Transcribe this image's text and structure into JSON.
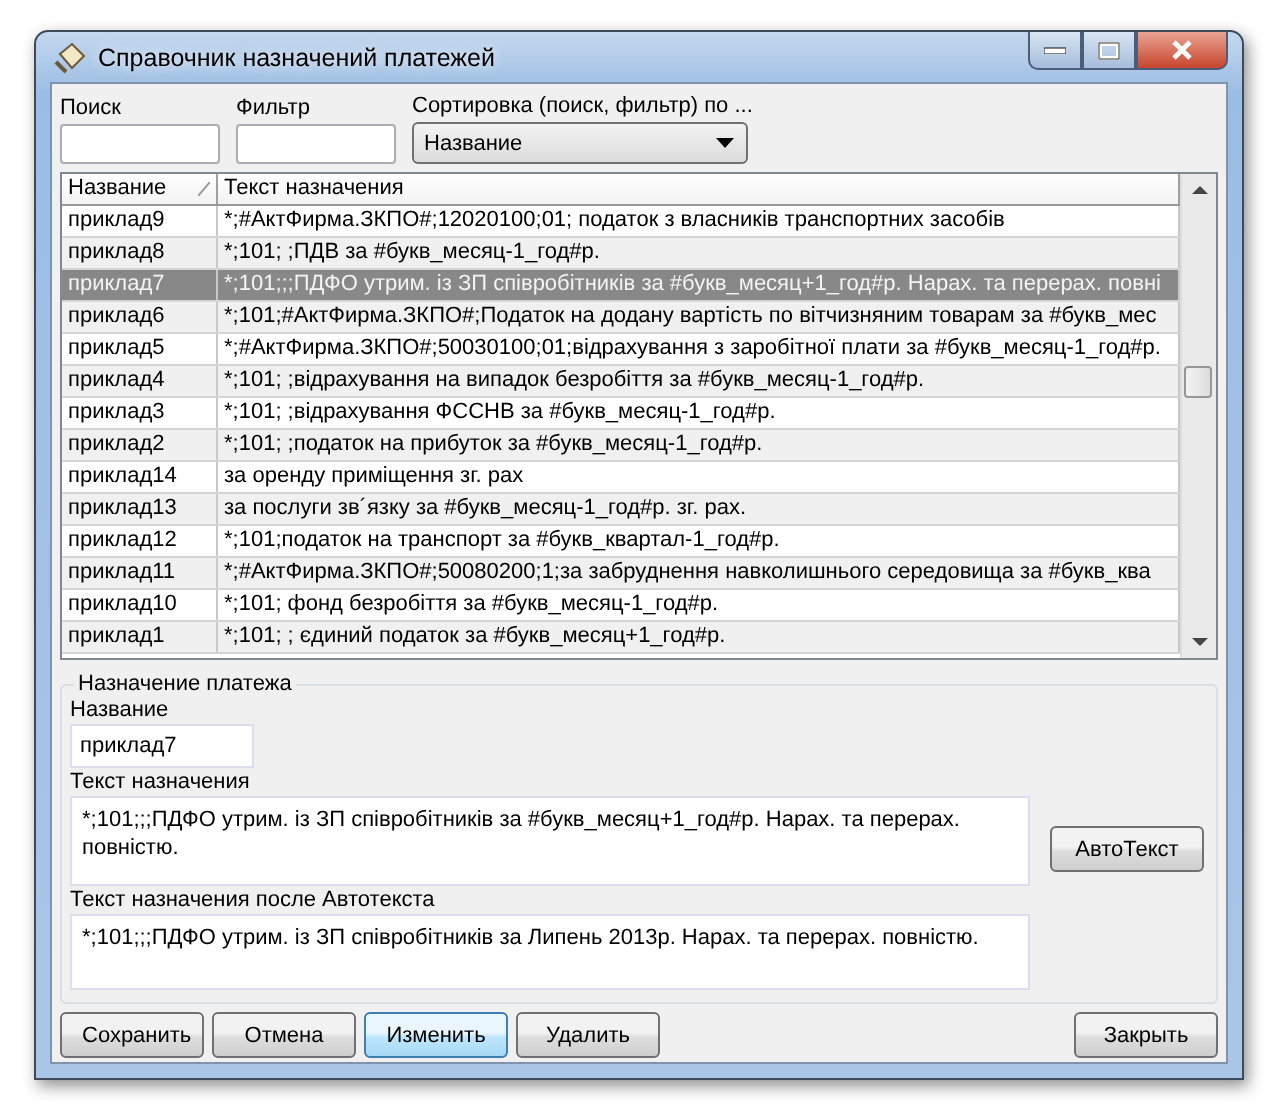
{
  "window": {
    "title": "Справочник назначений платежей"
  },
  "search": {
    "label": "Поиск"
  },
  "filter": {
    "label": "Фильтр"
  },
  "sort": {
    "label": "Сортировка (поиск, фильтр) по ...",
    "value": "Название"
  },
  "table": {
    "columns": [
      "Название",
      "Текст назначения"
    ],
    "rows": [
      {
        "name": "приклад9",
        "text": "*;#АктФирма.ЗКПО#;12020100;01; податок з власників транспортних засобів",
        "selected": false
      },
      {
        "name": "приклад8",
        "text": "*;101; ;ПДВ за #букв_месяц-1_год#р.",
        "selected": false
      },
      {
        "name": "приклад7",
        "text": "*;101;;;ПДФО утрим. із ЗП співробітників за #букв_месяц+1_год#р. Нарах. та перерах. повні",
        "selected": true
      },
      {
        "name": "приклад6",
        "text": "*;101;#АктФирма.ЗКПО#;Податок на додану вартість по вітчизняним товарам за #букв_мес",
        "selected": false
      },
      {
        "name": "приклад5",
        "text": "*;#АктФирма.ЗКПО#;50030100;01;відрахування з заробітної плати за #букв_месяц-1_год#р.",
        "selected": false
      },
      {
        "name": "приклад4",
        "text": "*;101; ;відрахування на випадок безробіття за #букв_месяц-1_год#р.",
        "selected": false
      },
      {
        "name": "приклад3",
        "text": "*;101; ;відрахування ФССНВ за #букв_месяц-1_год#р.",
        "selected": false
      },
      {
        "name": "приклад2",
        "text": "*;101; ;податок на прибуток за #букв_месяц-1_год#р.",
        "selected": false
      },
      {
        "name": "приклад14",
        "text": "за оренду приміщення зг. рах",
        "selected": false
      },
      {
        "name": "приклад13",
        "text": "за послуги зв´язку за #букв_месяц-1_год#р. зг. рах.",
        "selected": false
      },
      {
        "name": "приклад12",
        "text": "*;101;податок на транспорт за #букв_квартал-1_год#р.",
        "selected": false
      },
      {
        "name": "приклад11",
        "text": "*;#АктФирма.ЗКПО#;50080200;1;за забруднення навколишнього середовища за #букв_ква",
        "selected": false
      },
      {
        "name": "приклад10",
        "text": "*;101; фонд безробіття  за  #букв_месяц-1_год#р.",
        "selected": false
      },
      {
        "name": "приклад1",
        "text": "*;101; ; єдиний податок за #букв_месяц+1_год#р.",
        "selected": false
      }
    ]
  },
  "details": {
    "title": "Назначение платежа",
    "name_label": "Название",
    "name_value": "приклад7",
    "text_label": "Текст назначения",
    "text_value": "*;101;;;ПДФО утрим. із ЗП співробітників за #букв_месяц+1_год#р. Нарах. та перерах. повністю.",
    "autotext_button": "АвтоТекст",
    "result_label": "Текст назначения после Автотекста",
    "result_value": "*;101;;;ПДФО утрим. із ЗП співробітників за Липень 2013р. Нарах. та перерах. повністю."
  },
  "buttons": [
    {
      "label": "Сохранить",
      "highlighted": false
    },
    {
      "label": "Отмена",
      "highlighted": false
    },
    {
      "label": "Изменить",
      "highlighted": true
    },
    {
      "label": "Удалить",
      "highlighted": false
    }
  ],
  "close_button": "Закрыть"
}
